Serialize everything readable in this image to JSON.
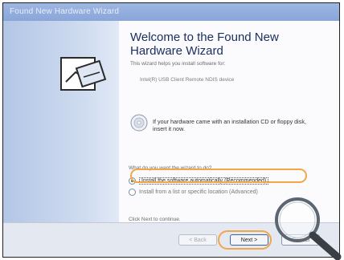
{
  "window": {
    "title": "Found New Hardware Wizard"
  },
  "wizard": {
    "heading": "Welcome to the Found New Hardware Wizard",
    "intro": "This wizard helps you install software for:",
    "device": "Intel(R) USB Client Remote NDIS device",
    "cd_hint": "If your hardware came with an installation CD or floppy disk, insert it now.",
    "question": "What do you want the wizard to do?",
    "options": [
      {
        "label": "Install the software automatically (Recommended)",
        "selected": true
      },
      {
        "label": "Install from a list or specific location (Advanced)",
        "selected": false
      }
    ],
    "continue_hint": "Click Next to continue."
  },
  "buttons": {
    "back": "< Back",
    "next": "Next >",
    "cancel": "Cancel"
  },
  "colors": {
    "highlight": "#f2a64a",
    "heading": "#1c2f61",
    "titlebar": "#8aa6d8"
  },
  "icons": [
    "hardware-icon",
    "cd-icon",
    "magnifier-icon"
  ]
}
